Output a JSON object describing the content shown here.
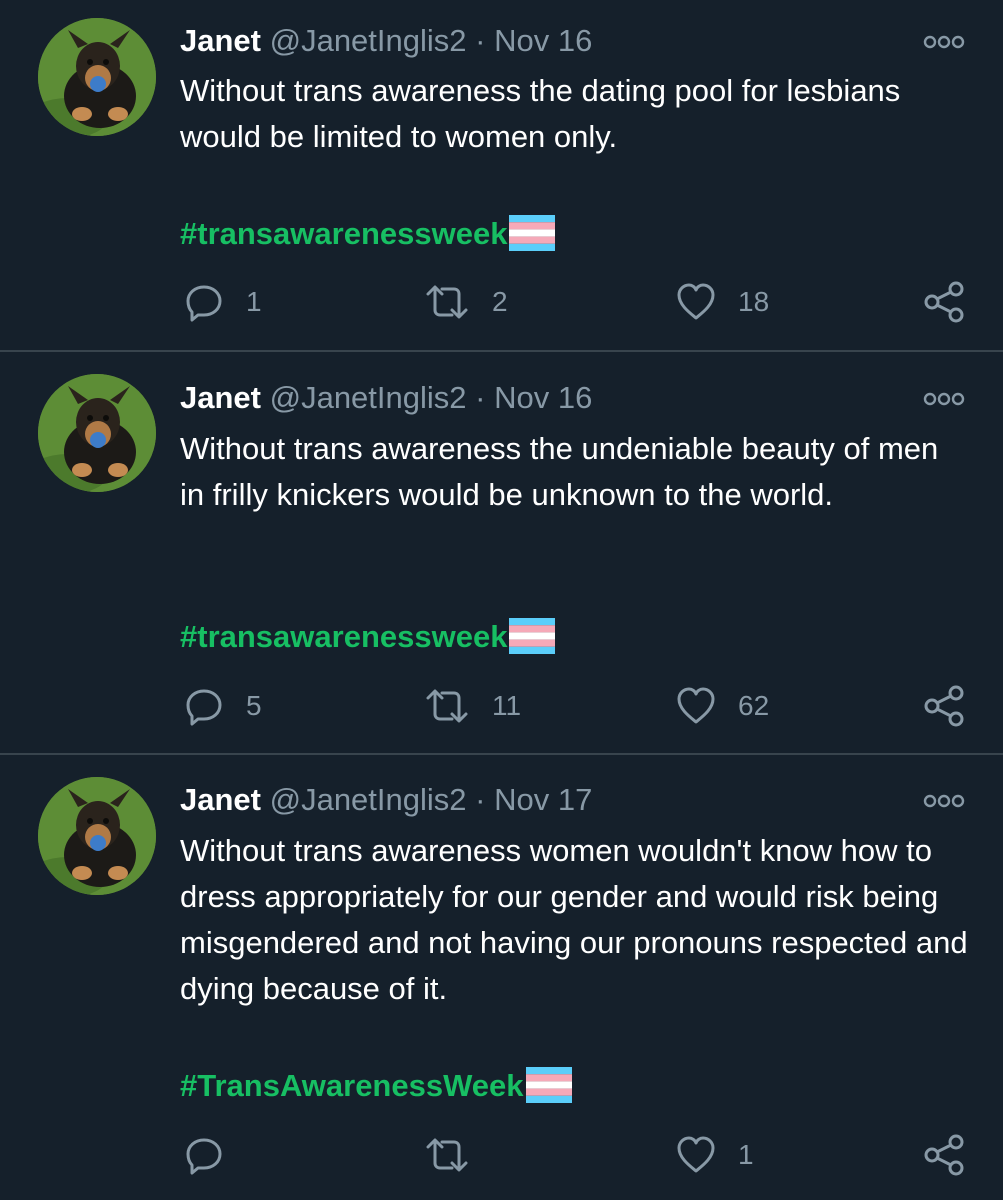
{
  "tweets": [
    {
      "name": "Janet",
      "handle": "@JanetInglis2",
      "separator": "·",
      "date": "Nov 16",
      "body": "Without trans awareness the dating pool for lesbians would be limited to women only.",
      "hashtag": "#transawarenessweek",
      "replies": "1",
      "retweets": "2",
      "likes": "18"
    },
    {
      "name": "Janet",
      "handle": "@JanetInglis2",
      "separator": "·",
      "date": "Nov 16",
      "body": "Without trans awareness the undeniable beauty of men in frilly knickers would be unknown to the world.",
      "hashtag": "#transawarenessweek",
      "replies": "5",
      "retweets": "11",
      "likes": "62"
    },
    {
      "name": "Janet",
      "handle": "@JanetInglis2",
      "separator": "·",
      "date": "Nov 17",
      "body": "Without trans awareness women wouldn't know how to dress appropriately for our gender and would risk being misgendered and not having our pronouns respected and dying because of it.",
      "hashtag": "#TransAwarenessWeek",
      "replies": "",
      "retweets": "",
      "likes": "1"
    }
  ],
  "icons": {
    "avatar": "dog-avatar",
    "more": "more-options-icon",
    "reply": "reply-icon",
    "retweet": "retweet-icon",
    "like": "heart-icon",
    "share": "share-icon",
    "flag": "transgender-flag-emoji"
  },
  "colors": {
    "background": "#15202b",
    "text": "#ffffff",
    "muted": "#8899a6",
    "hashtag": "#17bf63",
    "divider": "#38444d",
    "flag_blue": "#5bcefa",
    "flag_pink": "#f5a9b8",
    "flag_white": "#ffffff"
  }
}
